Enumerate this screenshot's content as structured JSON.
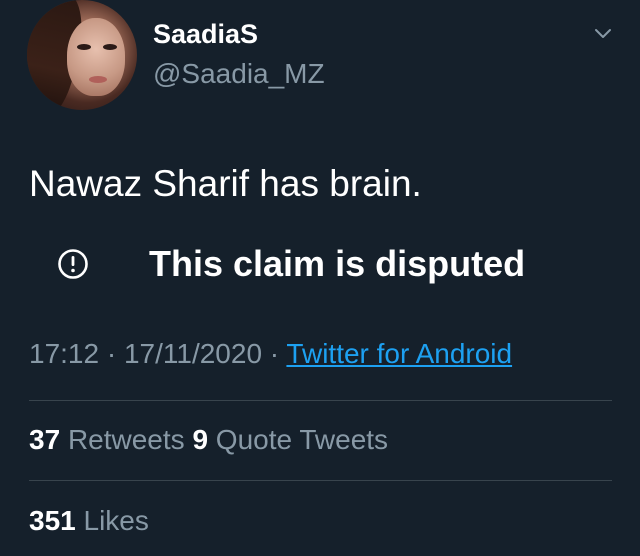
{
  "author": {
    "display_name": "SaadiaS",
    "handle": "@Saadia_MZ"
  },
  "tweet": {
    "text": "Nawaz Sharif has brain."
  },
  "label": {
    "text": "This claim is disputed",
    "icon": "alert-circle-icon"
  },
  "meta": {
    "time": "17:12",
    "sep1": " · ",
    "date": "17/11/2020",
    "sep2": " · ",
    "source": "Twitter for Android"
  },
  "stats": {
    "retweets_count": "37",
    "retweets_label": "Retweets",
    "quotes_count": "9",
    "quotes_label": "Quote Tweets",
    "likes_count": "351",
    "likes_label": "Likes"
  },
  "colors": {
    "background": "#15202b",
    "text_primary": "#ffffff",
    "text_secondary": "#8899a6",
    "link": "#1da1f2",
    "divider": "#38444d"
  },
  "icons": {
    "menu": "chevron-down-icon",
    "avatar": "user-avatar"
  }
}
